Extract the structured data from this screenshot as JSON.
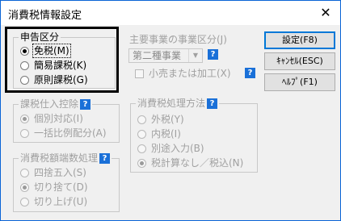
{
  "window": {
    "title": "消費税情報設定",
    "close_glyph": "✕"
  },
  "tax_category": {
    "label": "申告区分",
    "options": [
      {
        "label": "免税(M)",
        "checked": true
      },
      {
        "label": "簡易課税(K)",
        "checked": false
      },
      {
        "label": "原則課税(G)",
        "checked": false
      }
    ]
  },
  "main_business": {
    "label": "主要事業の事業区分(J)",
    "selected": "第二種事業",
    "retail_checkbox_label": "小売または加工(X)"
  },
  "buttons": {
    "settings": "設定(F8)",
    "cancel": "ｷｬﾝｾﾙ(ESC)",
    "help": "ﾍﾙﾌﾟ(F1)"
  },
  "purchase_deduction": {
    "label": "課税仕入控除",
    "options": [
      {
        "label": "個別対応(I)",
        "checked": true
      },
      {
        "label": "一括比例配分(A)",
        "checked": false
      }
    ]
  },
  "tax_method": {
    "label": "消費税処理方法",
    "options": [
      {
        "label": "外税(Y)",
        "checked": false
      },
      {
        "label": "内税(I)",
        "checked": false
      },
      {
        "label": "別途入力(B)",
        "checked": false
      },
      {
        "label": "税計算なし／税込(N)",
        "checked": true
      }
    ]
  },
  "rounding": {
    "label": "消費税額端数処理",
    "options": [
      {
        "label": "四捨五入(S)",
        "checked": false
      },
      {
        "label": "切り捨て(D)",
        "checked": true
      },
      {
        "label": "切り上げ(U)",
        "checked": false
      }
    ]
  },
  "help_glyph": "?",
  "select_arrow_glyph": "▼",
  "colors": {
    "title_border": "#0a64d6",
    "help_icon": "#1a70d8",
    "highlight_box": "#000000"
  }
}
